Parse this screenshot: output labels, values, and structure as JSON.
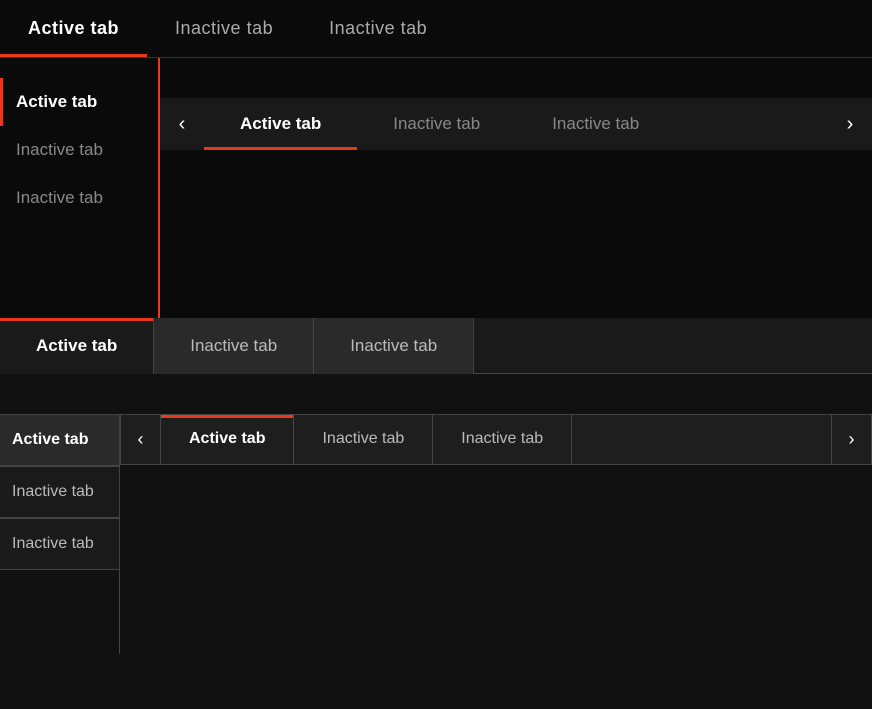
{
  "colors": {
    "accent": "#e8391c",
    "bg_dark": "#0a0a0a",
    "bg_mid": "#1a1a1a",
    "bg_light": "#2a2a2a",
    "text_active": "#ffffff",
    "text_inactive": "#888888"
  },
  "row1": {
    "tabs": [
      {
        "label": "Active tab",
        "state": "active"
      },
      {
        "label": "Inactive tab",
        "state": "inactive"
      },
      {
        "label": "Inactive tab",
        "state": "inactive"
      }
    ]
  },
  "row2": {
    "vertical": {
      "tabs": [
        {
          "label": "Active tab",
          "state": "active"
        },
        {
          "label": "Inactive tab",
          "state": "inactive"
        },
        {
          "label": "Inactive tab",
          "state": "inactive"
        }
      ]
    },
    "horizontal": {
      "prev_label": "‹",
      "next_label": "›",
      "tabs": [
        {
          "label": "Active tab",
          "state": "active"
        },
        {
          "label": "Inactive tab",
          "state": "inactive"
        },
        {
          "label": "Inactive tab",
          "state": "inactive"
        }
      ]
    }
  },
  "row3": {
    "tabs": [
      {
        "label": "Active tab",
        "state": "active"
      },
      {
        "label": "Inactive tab",
        "state": "inactive"
      },
      {
        "label": "Inactive tab",
        "state": "inactive"
      }
    ]
  },
  "row4": {
    "vertical": {
      "tabs": [
        {
          "label": "Active tab",
          "state": "active"
        },
        {
          "label": "Inactive tab",
          "state": "inactive"
        },
        {
          "label": "Inactive tab",
          "state": "inactive"
        }
      ]
    },
    "horizontal": {
      "prev_label": "‹",
      "next_label": "›",
      "tabs": [
        {
          "label": "Active tab",
          "state": "active"
        },
        {
          "label": "Inactive tab",
          "state": "inactive"
        },
        {
          "label": "Inactive tab",
          "state": "inactive"
        }
      ]
    }
  }
}
